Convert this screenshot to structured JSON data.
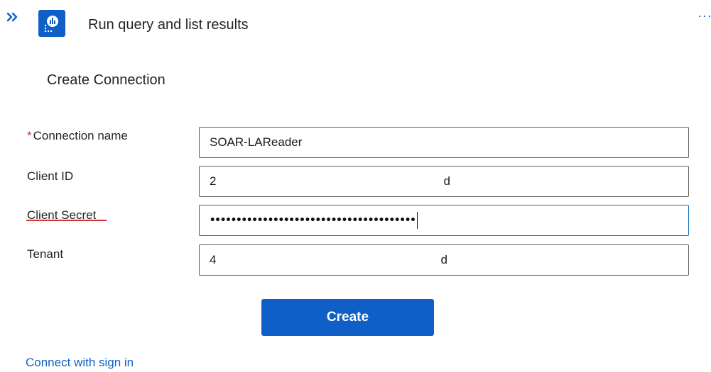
{
  "header": {
    "expand_icon": "double-chevron-right-icon",
    "action_icon": "log-analytics-icon",
    "title": "Run query and list results",
    "more_icon": "ellipsis-icon",
    "more_label": "···"
  },
  "form": {
    "title": "Create Connection",
    "fields": [
      {
        "label": "Connection name",
        "required": true,
        "value": "SOAR-LAReader"
      },
      {
        "label": "Client ID",
        "required": false,
        "value_start": "2",
        "value_end": "d"
      },
      {
        "label": "Client Secret",
        "required": false,
        "value": "•••••••••••••••••••••••••••••••••••••••"
      },
      {
        "label": "Tenant",
        "required": false,
        "value_start": "4",
        "value_end": "d"
      }
    ],
    "required_marker": "*",
    "create_label": "Create",
    "signin_link": "Connect with sign in"
  },
  "colors": {
    "accent": "#0f5fc6",
    "required": "#d13438",
    "focus_border": "#0f6cbd"
  }
}
